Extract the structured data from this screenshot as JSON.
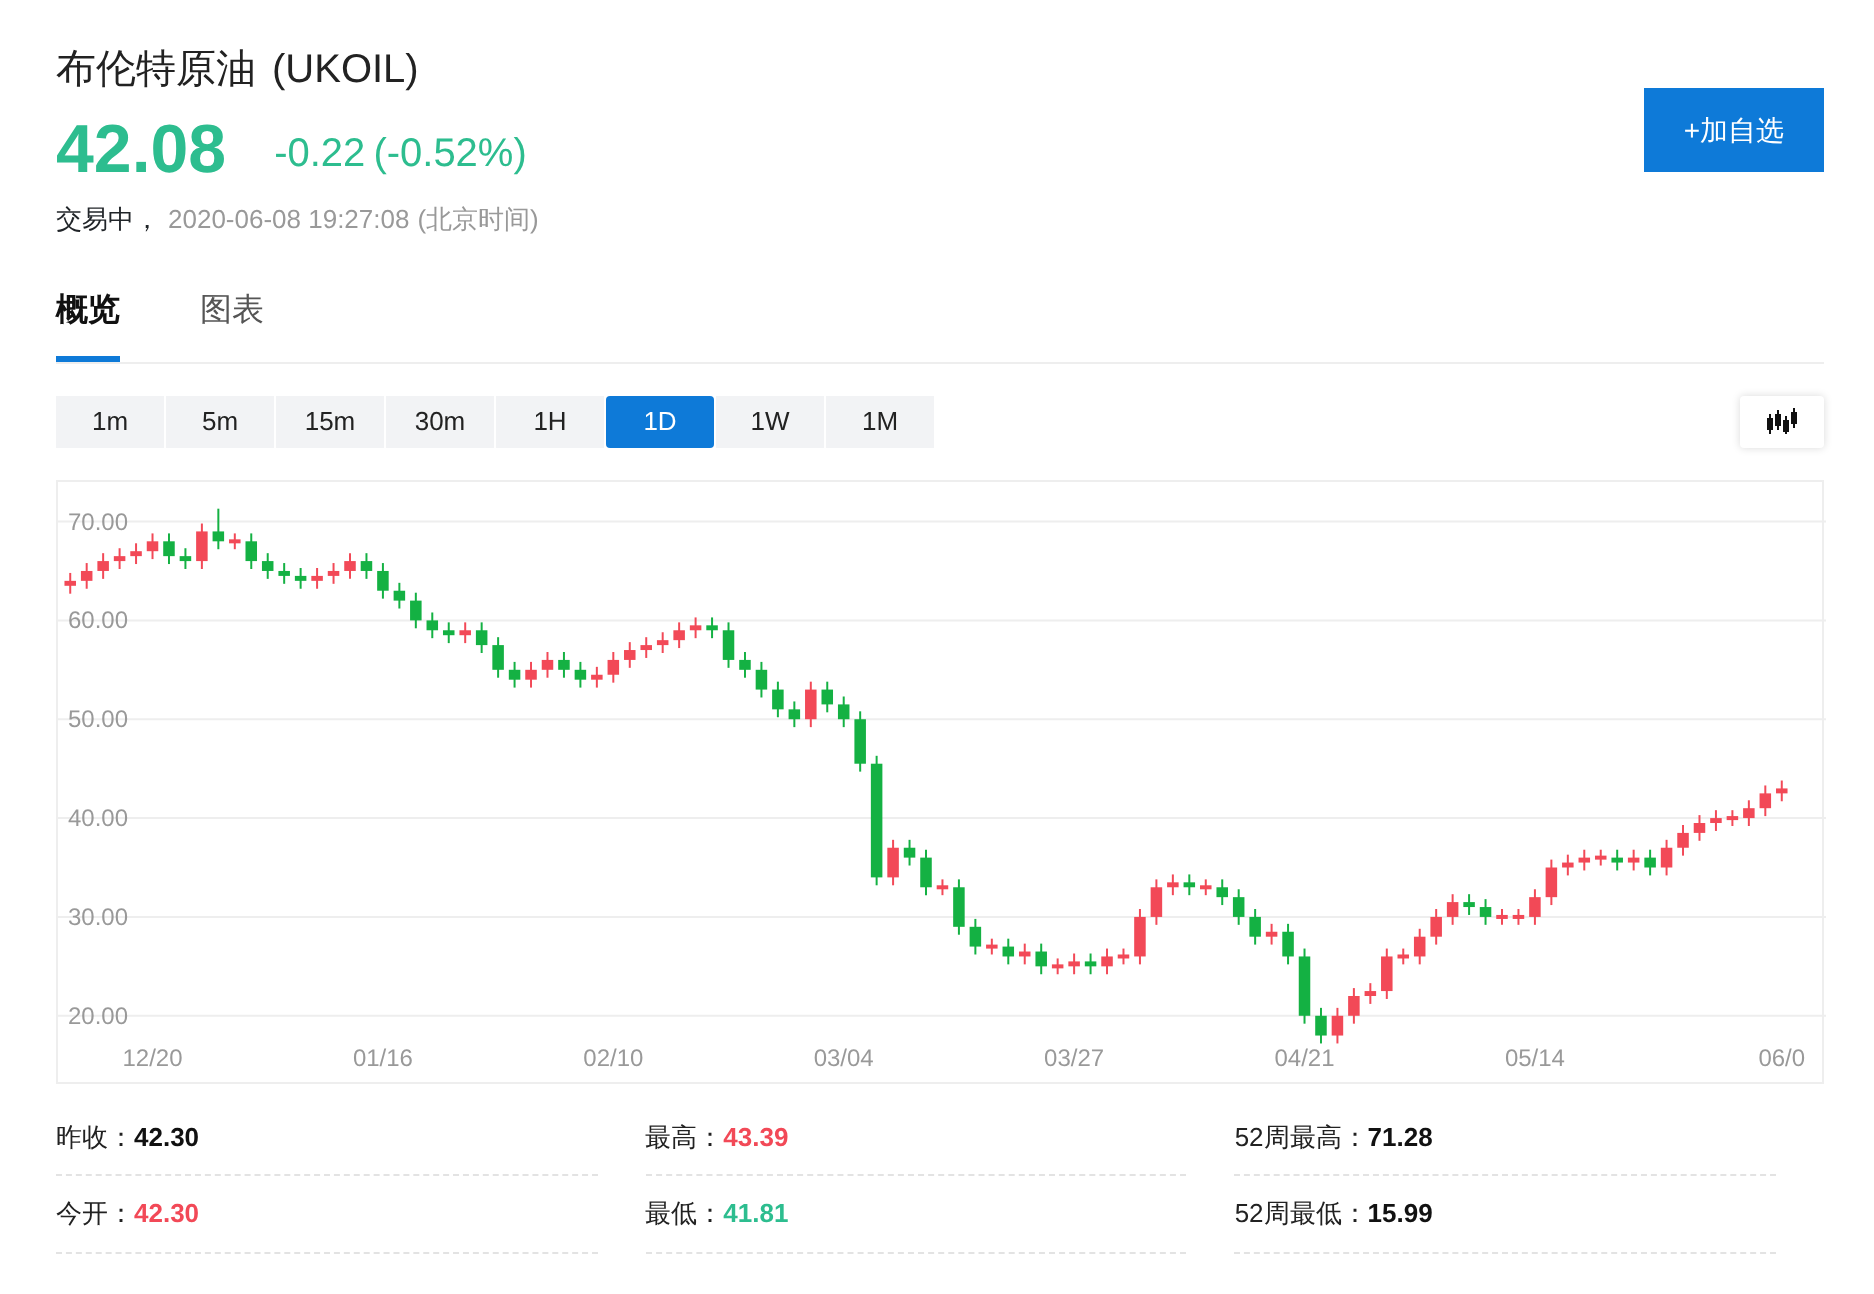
{
  "header": {
    "name": "布伦特原油",
    "symbol": "(UKOIL)",
    "price": "42.08",
    "change": "-0.22",
    "change_pct": "(-0.52%)",
    "color": "#2dbd8f",
    "status": "交易中，",
    "timestamp": "2020-06-08 19:27:08",
    "timezone": "(北京时间)",
    "watch_button": "+加自选"
  },
  "tabs": [
    {
      "label": "概览",
      "selected": true
    },
    {
      "label": "图表",
      "selected": false
    }
  ],
  "periods": [
    {
      "label": "1m",
      "selected": false
    },
    {
      "label": "5m",
      "selected": false
    },
    {
      "label": "15m",
      "selected": false
    },
    {
      "label": "30m",
      "selected": false
    },
    {
      "label": "1H",
      "selected": false
    },
    {
      "label": "1D",
      "selected": true
    },
    {
      "label": "1W",
      "selected": false
    },
    {
      "label": "1M",
      "selected": false
    }
  ],
  "chart": {
    "chart_data": {
      "type": "candlestick",
      "grid": true,
      "ylim": [
        13.3,
        74
      ],
      "yticks": [
        {
          "value": 70,
          "label": "70.00"
        },
        {
          "value": 60,
          "label": "60.00"
        },
        {
          "value": 50,
          "label": "50.00"
        },
        {
          "value": 40,
          "label": "40.00"
        },
        {
          "value": 30,
          "label": "30.00"
        },
        {
          "value": 20,
          "label": "20.00"
        }
      ],
      "categories": [
        null,
        null,
        null,
        null,
        null,
        "12/20",
        null,
        null,
        null,
        null,
        null,
        null,
        null,
        null,
        null,
        null,
        null,
        null,
        null,
        "01/16",
        null,
        null,
        null,
        null,
        null,
        null,
        null,
        null,
        null,
        null,
        null,
        null,
        null,
        "02/10",
        null,
        null,
        null,
        null,
        null,
        null,
        null,
        null,
        null,
        null,
        null,
        null,
        null,
        "03/04",
        null,
        null,
        null,
        null,
        null,
        null,
        null,
        null,
        null,
        null,
        null,
        null,
        null,
        "03/27",
        null,
        null,
        null,
        null,
        null,
        null,
        null,
        null,
        null,
        null,
        null,
        null,
        null,
        "04/21",
        null,
        null,
        null,
        null,
        null,
        null,
        null,
        null,
        null,
        null,
        null,
        null,
        null,
        "05/14",
        null,
        null,
        null,
        null,
        null,
        null,
        null,
        null,
        null,
        null,
        null,
        null,
        null,
        null,
        "06/0"
      ],
      "ohlc": [
        [
          63.5,
          64.8,
          62.7,
          64
        ],
        [
          64,
          65.8,
          63.2,
          65
        ],
        [
          65,
          66.8,
          64.2,
          66
        ],
        [
          66,
          67.3,
          65.2,
          66.5
        ],
        [
          66.5,
          67.8,
          65.7,
          67
        ],
        [
          67,
          68.8,
          66.2,
          68
        ],
        [
          68,
          68.8,
          65.7,
          66.5
        ],
        [
          66.5,
          67.3,
          65.2,
          66
        ],
        [
          66,
          69.8,
          65.2,
          69
        ],
        [
          69,
          71.3,
          67.2,
          68
        ],
        [
          68,
          68.8,
          67.2,
          68.2
        ],
        [
          68,
          68.8,
          65.2,
          66
        ],
        [
          66,
          66.8,
          64.2,
          65
        ],
        [
          65,
          65.8,
          63.7,
          64.5
        ],
        [
          64.5,
          65.3,
          63.2,
          64
        ],
        [
          64,
          65.3,
          63.2,
          64.5
        ],
        [
          64.5,
          65.8,
          63.7,
          65
        ],
        [
          65,
          66.8,
          64.2,
          66
        ],
        [
          66,
          66.8,
          64.2,
          65
        ],
        [
          65,
          65.8,
          62.2,
          63
        ],
        [
          63,
          63.8,
          61.2,
          62
        ],
        [
          62,
          62.8,
          59.2,
          60
        ],
        [
          60,
          60.8,
          58.2,
          59
        ],
        [
          59,
          59.8,
          57.7,
          58.5
        ],
        [
          58.5,
          59.8,
          57.7,
          59
        ],
        [
          59,
          59.8,
          56.7,
          57.5
        ],
        [
          57.5,
          58.3,
          54.2,
          55
        ],
        [
          55,
          55.8,
          53.2,
          54
        ],
        [
          54,
          55.8,
          53.2,
          55
        ],
        [
          55,
          56.8,
          54.2,
          56
        ],
        [
          56,
          56.8,
          54.2,
          55
        ],
        [
          55,
          55.8,
          53.2,
          54
        ],
        [
          54,
          55.3,
          53.2,
          54.5
        ],
        [
          54.5,
          56.8,
          53.7,
          56
        ],
        [
          56,
          57.8,
          55.2,
          57
        ],
        [
          57,
          58.3,
          56.2,
          57.5
        ],
        [
          57.5,
          58.8,
          56.7,
          58
        ],
        [
          58,
          59.8,
          57.2,
          59
        ],
        [
          59,
          60.3,
          58.2,
          59.5
        ],
        [
          59.5,
          60.3,
          58.2,
          59
        ],
        [
          59,
          59.8,
          55.2,
          56
        ],
        [
          56,
          56.8,
          54.2,
          55
        ],
        [
          55,
          55.8,
          52.2,
          53
        ],
        [
          53,
          53.8,
          50.2,
          51
        ],
        [
          51,
          51.8,
          49.2,
          50
        ],
        [
          50,
          53.8,
          49.2,
          53
        ],
        [
          53,
          53.8,
          50.7,
          51.5
        ],
        [
          51.5,
          52.3,
          49.2,
          50
        ],
        [
          50,
          50.8,
          44.7,
          45.5
        ],
        [
          45.5,
          46.3,
          33.2,
          34
        ],
        [
          34,
          37.8,
          33.2,
          37
        ],
        [
          37,
          37.8,
          35.2,
          36
        ],
        [
          36,
          36.8,
          32.2,
          33
        ],
        [
          33,
          33.8,
          32.2,
          33.2
        ],
        [
          33,
          33.8,
          28.2,
          29
        ],
        [
          29,
          29.8,
          26.2,
          27
        ],
        [
          27,
          27.8,
          26.2,
          27.2
        ],
        [
          27,
          27.8,
          25.2,
          26
        ],
        [
          26,
          27.3,
          25.2,
          26.5
        ],
        [
          26.5,
          27.3,
          24.2,
          25
        ],
        [
          25,
          25.8,
          24.2,
          25.2
        ],
        [
          25,
          26.3,
          24.2,
          25.5
        ],
        [
          25.5,
          26.3,
          24.2,
          25
        ],
        [
          25,
          26.8,
          24.2,
          26
        ],
        [
          26,
          26.8,
          25.2,
          26.2
        ],
        [
          26,
          30.8,
          25.2,
          30
        ],
        [
          30,
          33.8,
          29.2,
          33
        ],
        [
          33,
          34.3,
          32.2,
          33.5
        ],
        [
          33.5,
          34.3,
          32.2,
          33
        ],
        [
          33,
          33.8,
          32.2,
          33.2
        ],
        [
          33,
          33.8,
          31.2,
          32
        ],
        [
          32,
          32.8,
          29.2,
          30
        ],
        [
          30,
          30.8,
          27.2,
          28
        ],
        [
          28,
          29.3,
          27.2,
          28.5
        ],
        [
          28.5,
          29.3,
          25.2,
          26
        ],
        [
          26,
          26.8,
          19.2,
          20
        ],
        [
          20,
          20.8,
          17.2,
          18
        ],
        [
          18,
          20.8,
          17.2,
          20
        ],
        [
          20,
          22.8,
          19.2,
          22
        ],
        [
          22,
          23.3,
          21.2,
          22.5
        ],
        [
          22.5,
          26.8,
          21.7,
          26
        ],
        [
          26,
          26.8,
          25.2,
          26.2
        ],
        [
          26,
          28.8,
          25.2,
          28
        ],
        [
          28,
          30.8,
          27.2,
          30
        ],
        [
          30,
          32.3,
          29.2,
          31.5
        ],
        [
          31.5,
          32.3,
          30.2,
          31
        ],
        [
          31,
          31.8,
          29.2,
          30
        ],
        [
          30,
          30.8,
          29.2,
          30.2
        ],
        [
          30,
          30.8,
          29.2,
          30.2
        ],
        [
          30,
          32.8,
          29.2,
          32
        ],
        [
          32,
          35.8,
          31.2,
          35
        ],
        [
          35,
          36.3,
          34.2,
          35.5
        ],
        [
          35.5,
          36.8,
          34.7,
          36
        ],
        [
          36,
          36.8,
          35.2,
          36.2
        ],
        [
          36,
          36.8,
          34.7,
          35.5
        ],
        [
          35.5,
          36.8,
          34.7,
          36
        ],
        [
          36,
          36.8,
          34.2,
          35
        ],
        [
          35,
          37.8,
          34.2,
          37
        ],
        [
          37,
          39.3,
          36.2,
          38.5
        ],
        [
          38.5,
          40.3,
          37.7,
          39.5
        ],
        [
          39.5,
          40.8,
          38.7,
          40
        ],
        [
          40,
          40.8,
          39.2,
          40.2
        ],
        [
          40,
          41.8,
          39.2,
          41
        ],
        [
          41,
          43.3,
          40.2,
          42.5
        ],
        [
          42.5,
          43.8,
          41.7,
          43
        ]
      ]
    }
  },
  "stats": [
    {
      "label": "昨收：",
      "value": "42.30",
      "color": "#111111"
    },
    {
      "label": "最高：",
      "value": "43.39",
      "color": "#f24957"
    },
    {
      "label": "52周最高：",
      "value": "71.28",
      "color": "#111111"
    },
    {
      "label": "今开：",
      "value": "42.30",
      "color": "#f24957"
    },
    {
      "label": "最低：",
      "value": "41.81",
      "color": "#2dbd8f"
    },
    {
      "label": "52周最低：",
      "value": "15.99",
      "color": "#111111"
    }
  ]
}
